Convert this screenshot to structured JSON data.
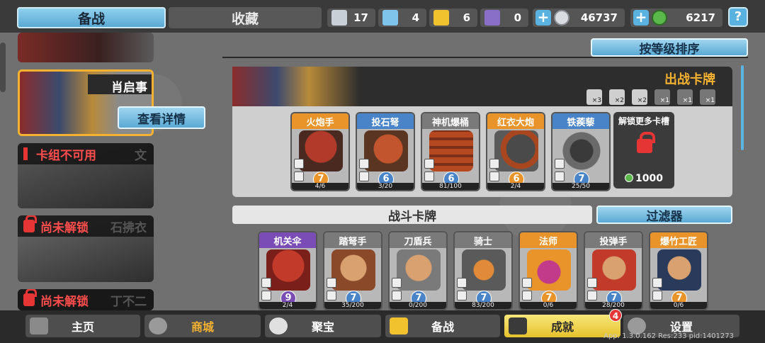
{
  "tabs": {
    "active": "备战",
    "collection": "收藏"
  },
  "resources": [
    {
      "name": "silver-ticket",
      "value": "17",
      "color": "#c9cfd6"
    },
    {
      "name": "blue-crystal",
      "value": "4",
      "color": "#7fc4ea"
    },
    {
      "name": "gold-ticket",
      "value": "6",
      "color": "#f2c12e"
    },
    {
      "name": "purple-ticket",
      "value": "0",
      "color": "#8a6fc9"
    }
  ],
  "currency": {
    "silver": "46737",
    "gems": "6217"
  },
  "help_label": "?",
  "decks": [
    {
      "name": "肖启事",
      "detail_label": "查看详情"
    },
    {
      "warning": "卡组不可用",
      "ghost": "文"
    },
    {
      "locked": "尚未解锁",
      "ghost": "石拂衣"
    },
    {
      "locked": "尚未解锁",
      "ghost": "丁不二"
    }
  ],
  "sort_label": "按等级排序",
  "deck_panel": {
    "title": "出战卡牌",
    "slots": [
      "×3",
      "×2",
      "×2",
      "×1",
      "×1",
      "×1"
    ],
    "cards": [
      {
        "name": "火炮手",
        "level": "7",
        "progress": "4/6",
        "rarity": "orange"
      },
      {
        "name": "投石弩",
        "level": "6",
        "progress": "3/20",
        "rarity": "blue"
      },
      {
        "name": "神机爆桶",
        "level": "6",
        "progress": "81/100",
        "rarity": "gray"
      },
      {
        "name": "红衣大炮",
        "level": "6",
        "progress": "2/4",
        "rarity": "orange"
      },
      {
        "name": "铁蒺藜",
        "level": "7",
        "progress": "25/50",
        "rarity": "blue"
      }
    ],
    "unlock_title": "解锁更多卡槽",
    "unlock_cost": "1000"
  },
  "battle_section": {
    "title": "战斗卡牌",
    "filter_label": "过滤器"
  },
  "battle_cards": [
    {
      "name": "机关伞",
      "level": "9",
      "progress": "2/4",
      "rarity": "purple"
    },
    {
      "name": "踏弩手",
      "level": "7",
      "progress": "35/200",
      "rarity": "gray"
    },
    {
      "name": "刀盾兵",
      "level": "7",
      "progress": "0/200",
      "rarity": "gray"
    },
    {
      "name": "骑士",
      "level": "7",
      "progress": "83/200",
      "rarity": "gray"
    },
    {
      "name": "法师",
      "level": "7",
      "progress": "0/6",
      "rarity": "orange"
    },
    {
      "name": "投弹手",
      "level": "7",
      "progress": "28/200",
      "rarity": "gray"
    },
    {
      "name": "爆竹工匠",
      "level": "7",
      "progress": "0/6",
      "rarity": "orange"
    }
  ],
  "nav": [
    {
      "label": "主页",
      "icon": "home-icon"
    },
    {
      "label": "商城",
      "icon": "shop-icon"
    },
    {
      "label": "聚宝",
      "icon": "treasure-icon"
    },
    {
      "label": "备战",
      "icon": "deck-icon"
    },
    {
      "label": "成就",
      "icon": "achievement-icon"
    },
    {
      "label": "设置",
      "icon": "gear-icon"
    }
  ],
  "achievement_badge": "4",
  "version": "App: 1.3.0.162 Res:233 pid:1401273"
}
